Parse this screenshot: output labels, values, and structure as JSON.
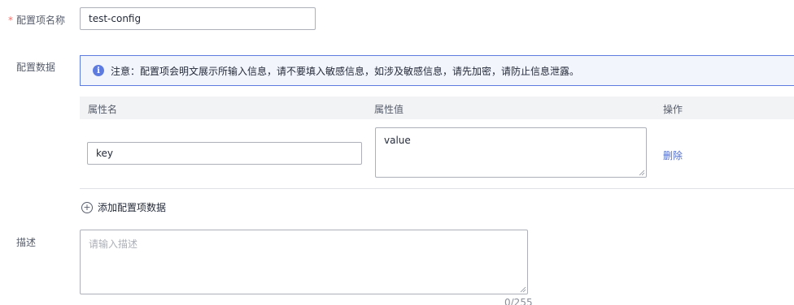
{
  "form": {
    "name_label": "配置项名称",
    "name_required_mark": "*",
    "name_value": "test-config",
    "data_label": "配置数据",
    "description_label": "描述",
    "description_placeholder": "请输入描述",
    "description_counter": "0/255"
  },
  "notice": {
    "icon": "info-icon",
    "icon_glyph": "i",
    "text": "注意：配置项会明文展示所输入信息，请不要填入敏感信息，如涉及敏感信息，请先加密，请防止信息泄露。"
  },
  "table": {
    "headers": [
      "属性名",
      "属性值",
      "操作"
    ],
    "rows": [
      {
        "key": "key",
        "value": "value",
        "action": "删除"
      }
    ]
  },
  "add_row": {
    "icon": "plus-circle-icon",
    "icon_glyph": "+",
    "label": "添加配置项数据"
  },
  "colors": {
    "accent": "#5e7ce0",
    "link": "#526ecc",
    "required": "#f66f6a",
    "notice_bg": "#f2f5fc",
    "table_header_bg": "#f2f3f5"
  }
}
